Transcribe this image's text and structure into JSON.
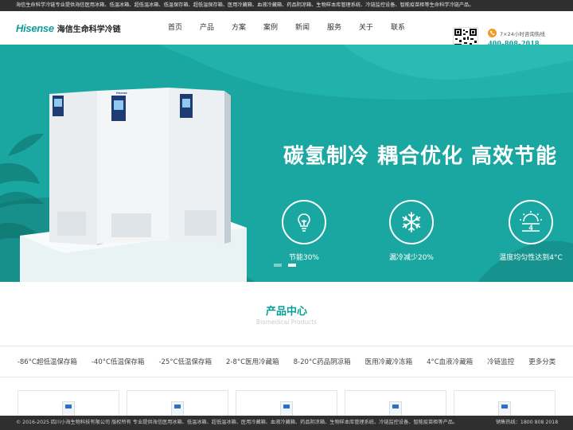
{
  "topbar": {
    "text": "海信生命科学冷链专业提供海信医用冰箱、低温冰箱、超低温冰箱、低温保存箱、超低温保存箱、医用冷藏箱、血液冷藏箱、药品阴凉箱、生物样本库管理系统、冷链监控设备、智能疫苗柜等生命科学冷链产品。"
  },
  "header": {
    "logo_brand": "Hisense",
    "logo_text": "海信生命科学冷链",
    "nav": [
      "首页",
      "产品",
      "方案",
      "案例",
      "新闻",
      "服务",
      "关于",
      "联系"
    ],
    "hotline_label": "7×24小时咨询热线",
    "hotline_number": "400-808-2018"
  },
  "banner": {
    "headline": "碳氢制冷  耦合优化  高效节能",
    "features": [
      {
        "icon": "lightbulb-icon",
        "label": "节能30%"
      },
      {
        "icon": "snowflake-icon",
        "label": "漏冷减少20%"
      },
      {
        "icon": "thermometer-4-icon",
        "label": "温度均匀性达到4°C"
      }
    ],
    "feature_icon_text": "4",
    "fridge_brand": "Hisense",
    "active_slide": 2,
    "slide_count": 2
  },
  "products": {
    "title": "产品中心",
    "subtitle": "Biomedical Products",
    "categories": [
      "-86°C超低温保存箱",
      "-40°C低温保存箱",
      "-25°C低温保存箱",
      "2-8°C医用冷藏箱",
      "8-20°C药品阴凉箱",
      "医用冷藏冷冻箱",
      "4°C血液冷藏箱",
      "冷链监控",
      "更多分类"
    ]
  },
  "footer": {
    "copyright": "© 2016-2025 四川小海生物科技有限公司 版权所有  专业提供海信医用冰箱、低温冰箱、超低温冰箱、医用冷藏箱、血液冷藏箱、药品阴凉箱、生物样本库管理系统、冷链监控设备、智能疫苗柜等产品。",
    "sales_hotline": "销售热线：1800 808 2018"
  },
  "colors": {
    "brand": "#0a9e98",
    "banner_bg": "#1ba7a1",
    "dark_bar": "#2f2f2f",
    "phone_icon": "#f29b26"
  }
}
